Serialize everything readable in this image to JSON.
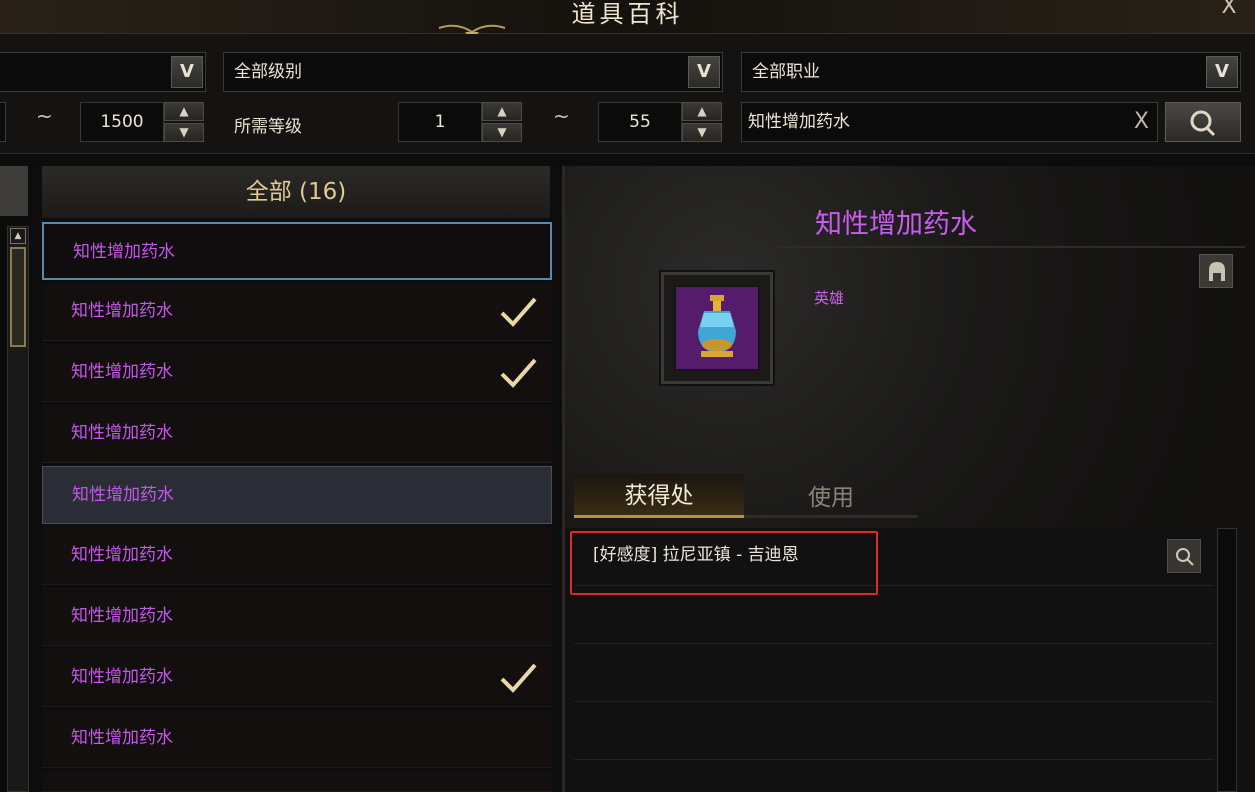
{
  "window": {
    "title": "道具百科",
    "close_label": "X"
  },
  "filters": {
    "dropdown1_value": "",
    "grade_dropdown": "全部级别",
    "class_dropdown": "全部职业",
    "item_level_max": "1500",
    "required_level_label": "所需等级",
    "required_level_min": "1",
    "required_level_max": "55",
    "tilde": "~",
    "search_text": "知性增加药水",
    "clear_label": "X",
    "dropdown_arrow": "V",
    "step_up": "▲",
    "step_down": "▼"
  },
  "list": {
    "header": "全部 (16)",
    "items": [
      {
        "name": "知性增加药水",
        "checked": false
      },
      {
        "name": "知性增加药水",
        "checked": true
      },
      {
        "name": "知性增加药水",
        "checked": true
      },
      {
        "name": "知性增加药水",
        "checked": false
      },
      {
        "name": "知性增加药水",
        "checked": false
      },
      {
        "name": "知性增加药水",
        "checked": false
      },
      {
        "name": "知性增加药水",
        "checked": false
      },
      {
        "name": "知性增加药水",
        "checked": true
      },
      {
        "name": "知性增加药水",
        "checked": false
      }
    ]
  },
  "detail": {
    "item_name": "知性增加药水",
    "rarity": "英雄",
    "tabs": [
      "获得处",
      "使用"
    ],
    "acquire_sources": [
      "[好感度] 拉尼亚镇 - 吉迪恩"
    ]
  },
  "colors": {
    "accent_purple": "#c657ec",
    "gold": "#e2c98f",
    "highlight_red": "#e02a24"
  }
}
